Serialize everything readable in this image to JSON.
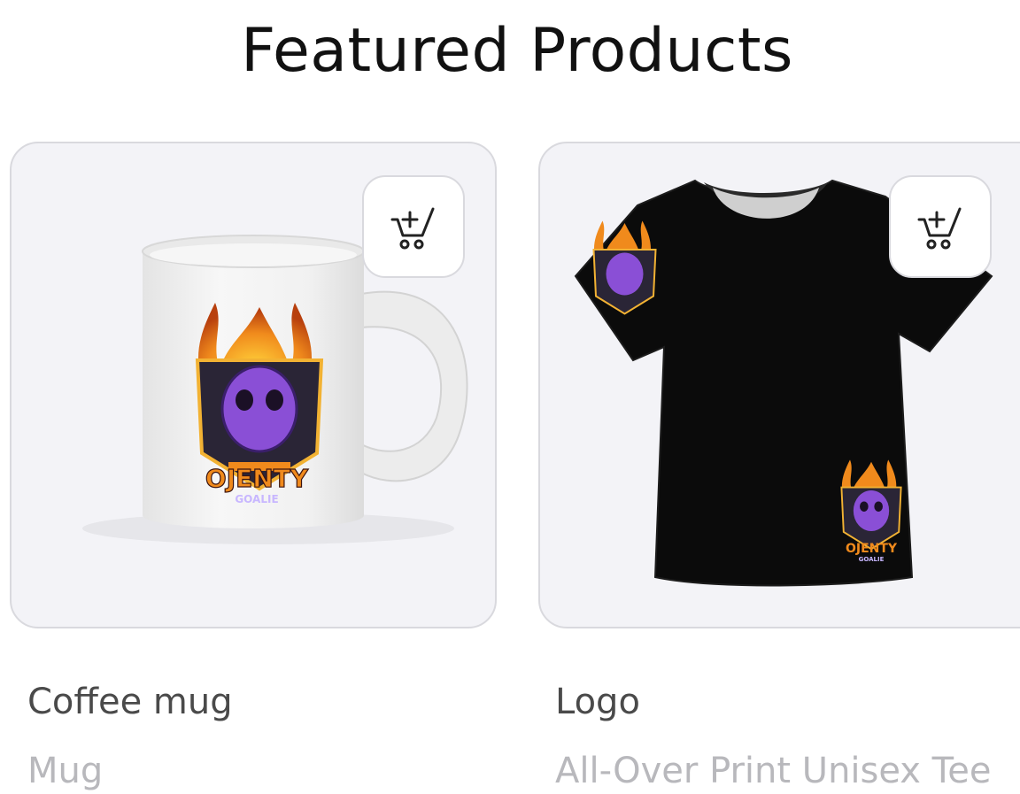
{
  "section": {
    "title": "Featured Products"
  },
  "products": [
    {
      "name": "Coffee mug",
      "type": "Mug",
      "logo_text": "OJENTY",
      "logo_subtext": "GOALIE"
    },
    {
      "name": "Logo",
      "type": "All-Over Print Unisex Tee",
      "logo_text": "OJENTY",
      "logo_subtext": "GOALIE"
    }
  ],
  "icons": {
    "cart": "add-to-cart-icon"
  },
  "colors": {
    "card_bg": "#f3f3f7",
    "card_border": "#d9d9de",
    "title": "#111111",
    "product_name": "#4a4a4a",
    "product_type": "#b8b8bc",
    "logo_purple": "#8a4fd6",
    "logo_orange": "#f08a1c"
  }
}
